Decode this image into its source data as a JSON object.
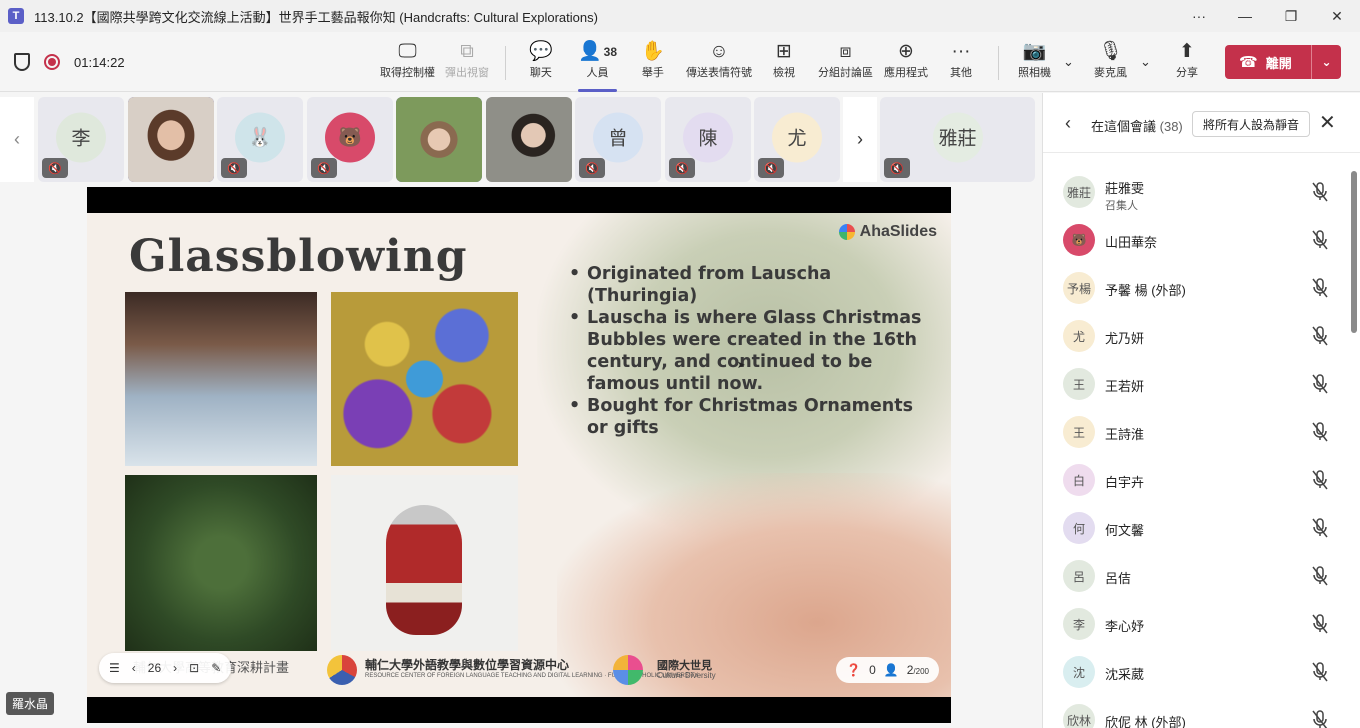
{
  "window": {
    "title": "113.10.2【國際共學跨文化交流線上活動】世界手工藝品報你知 (Handcrafts: Cultural Explorations)",
    "more": "···",
    "minimize": "—",
    "restore": "❐",
    "close": "✕"
  },
  "meeting": {
    "timer": "01:14:22"
  },
  "toolbar": {
    "take_control": "取得控制權",
    "popout": "彈出視窗",
    "chat": "聊天",
    "people": "人員",
    "people_count": "38",
    "raise_hand": "舉手",
    "reactions": "傳送表情符號",
    "view": "檢視",
    "breakout": "分組討論區",
    "apps": "應用程式",
    "more": "其他",
    "camera": "照相機",
    "mic": "麥克風",
    "share": "分享",
    "leave": "離開"
  },
  "strip": {
    "tiles": [
      {
        "initial": "李",
        "color": "#dfe8dc"
      },
      {
        "initial": "",
        "color": "#c9b5a5"
      },
      {
        "initial": "",
        "color": "#cfe4ea"
      },
      {
        "initial": "",
        "color": "#e6d5e6"
      },
      {
        "initial": "",
        "color": "#8aa36c"
      },
      {
        "initial": "",
        "color": "#9a9a92"
      },
      {
        "initial": "曾",
        "color": "#d6e2f2"
      },
      {
        "initial": "陳",
        "color": "#e3dcf0"
      },
      {
        "initial": "尤",
        "color": "#f8ecd2"
      },
      {
        "initial": "雅莊",
        "color": "#e4ece2"
      }
    ]
  },
  "slide": {
    "title": "Glassblowing",
    "brand": "AhaSlides",
    "bullets": [
      "Originated from Lauscha (Thuringia)",
      "Lauscha is where Glass Christmas Bubbles were created in the 16th century, and continued to be famous until now.",
      "Bought for Christmas Ornaments or gifts"
    ],
    "footer_plan": "輔仁大學高等教育深耕計畫",
    "footer_center": "輔仁大學外語教學與數位學習資源中心",
    "footer_center_sub": "RESOURCE CENTER OF FOREIGN LANGUAGE TEACHING AND DIGITAL LEARNING · FU JEN CATHOLIC UNIVERSITY",
    "footer_right": "國際大世見",
    "footer_right_sub": "Culture Diversity",
    "current_page": "26",
    "questions": "0",
    "audience": "2",
    "audience_max": "/200"
  },
  "presenter_name": "羅水晶",
  "panel": {
    "title": "在這個會議",
    "count": "(38)",
    "mute_all": "將所有人設為靜音",
    "participants": [
      {
        "initials": "雅莊",
        "name": "莊雅雯",
        "role": "召集人",
        "color": "#e2e9df"
      },
      {
        "initials": "",
        "name": "山田華奈",
        "role": "",
        "color": "#d84a6a"
      },
      {
        "initials": "予楊",
        "name": "予馨 楊 (外部)",
        "role": "",
        "color": "#f8ecd2"
      },
      {
        "initials": "尤",
        "name": "尤乃妍",
        "role": "",
        "color": "#f8ecd2"
      },
      {
        "initials": "王",
        "name": "王若妍",
        "role": "",
        "color": "#e2e9df"
      },
      {
        "initials": "王",
        "name": "王詩淮",
        "role": "",
        "color": "#f8ecd2"
      },
      {
        "initials": "白",
        "name": "白宇卉",
        "role": "",
        "color": "#efdcee"
      },
      {
        "initials": "何",
        "name": "何文馨",
        "role": "",
        "color": "#e3dcf0"
      },
      {
        "initials": "呂",
        "name": "呂佶",
        "role": "",
        "color": "#e2e9df"
      },
      {
        "initials": "李",
        "name": "李心妤",
        "role": "",
        "color": "#e2e9df"
      },
      {
        "initials": "沈",
        "name": "沈采葳",
        "role": "",
        "color": "#d9eef0"
      },
      {
        "initials": "欣林",
        "name": "欣伲 林 (外部)",
        "role": "",
        "color": "#e2e9df"
      }
    ]
  },
  "colors": {
    "accent": "#5b5fc7",
    "leave": "#c4314b"
  }
}
